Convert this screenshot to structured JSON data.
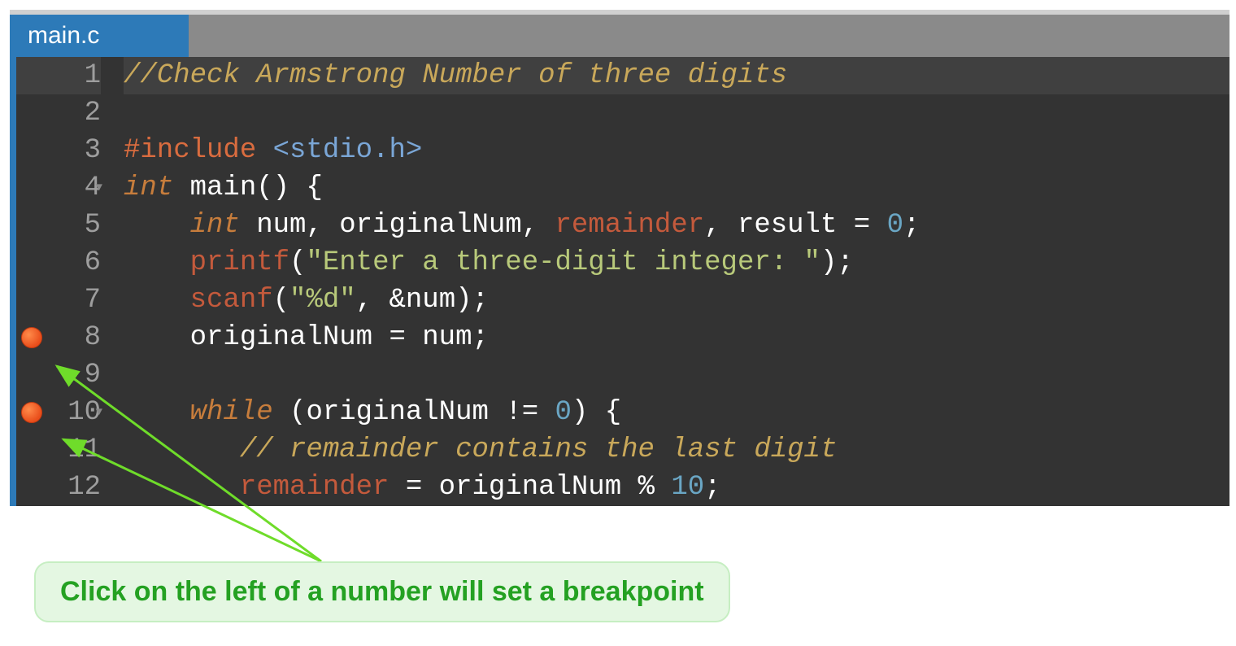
{
  "tab": {
    "filename": "main.c"
  },
  "gutter": {
    "lines": [
      "1",
      "2",
      "3",
      "4",
      "5",
      "6",
      "7",
      "8",
      "9",
      "10",
      "11",
      "12"
    ],
    "breakpoints": [
      8,
      10
    ],
    "folds": [
      4,
      10
    ],
    "active": 1
  },
  "code": {
    "l1_comment": "//Check Armstrong Number of three digits",
    "l2": "",
    "l3_include_kw": "#include",
    "l3_include_val": " <stdio.h>",
    "l4_kw": "int",
    "l4_rest": " main() {",
    "l5_kw": "    int",
    "l5_a": " num, originalNum, ",
    "l5_rem": "remainder",
    "l5_b": ", result = ",
    "l5_num": "0",
    "l5_c": ";",
    "l6_fn": "    printf",
    "l6_p": "(",
    "l6_str": "\"Enter a three-digit integer: \"",
    "l6_end": ");",
    "l7_fn": "    scanf",
    "l7_p": "(",
    "l7_str": "\"%d\"",
    "l7_mid": ", &num);",
    "l8": "    originalNum = num;",
    "l9": "",
    "l10_kw": "    while",
    "l10_a": " (originalNum != ",
    "l10_num": "0",
    "l10_b": ") {",
    "l11_comment": "       // remainder contains the last digit",
    "l12_a": "       ",
    "l12_rem": "remainder",
    "l12_b": " = originalNum % ",
    "l12_num": "10",
    "l12_c": ";"
  },
  "annotation": {
    "text": "Click on the left of a number will set a breakpoint"
  }
}
